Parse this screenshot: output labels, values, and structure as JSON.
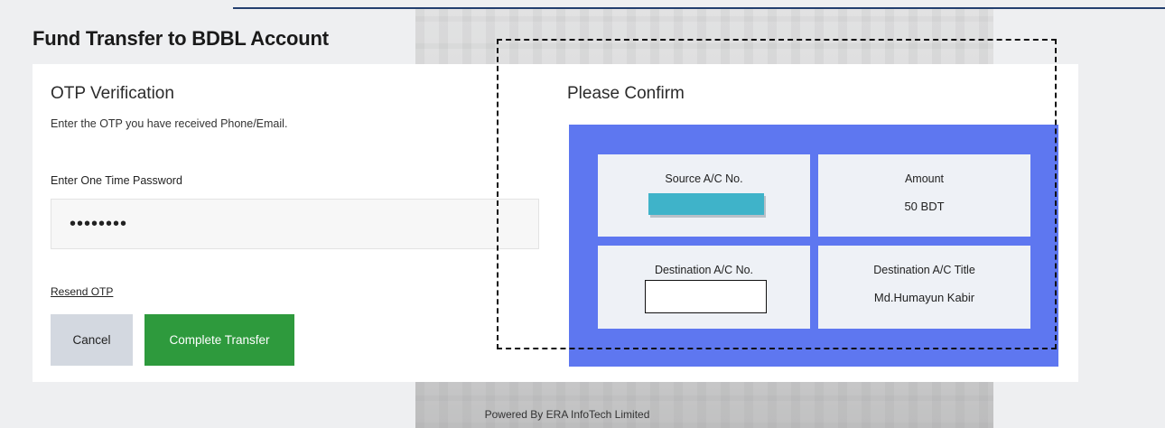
{
  "page": {
    "title": "Fund Transfer to BDBL Account"
  },
  "otp": {
    "heading": "OTP Verification",
    "instructions": "Enter the OTP you have received Phone/Email.",
    "label": "Enter One Time Password",
    "value": "••••••••",
    "resend_label": "Resend OTP",
    "cancel_label": "Cancel",
    "complete_label": "Complete Transfer"
  },
  "confirm": {
    "heading": "Please Confirm",
    "source_label": "Source A/C No.",
    "amount_label": "Amount",
    "amount_value": "50 BDT",
    "destination_label": "Destination A/C No.",
    "destination_title_label": "Destination A/C Title",
    "destination_title_value": "Md.Humayun Kabir"
  },
  "footer": {
    "text": "Powered By ERA InfoTech Limited"
  },
  "colors": {
    "panel_blue": "#5e77f0",
    "complete_green": "#2e9a3d",
    "cancel_gray": "#d3d8e0",
    "header_line": "#24406f"
  }
}
